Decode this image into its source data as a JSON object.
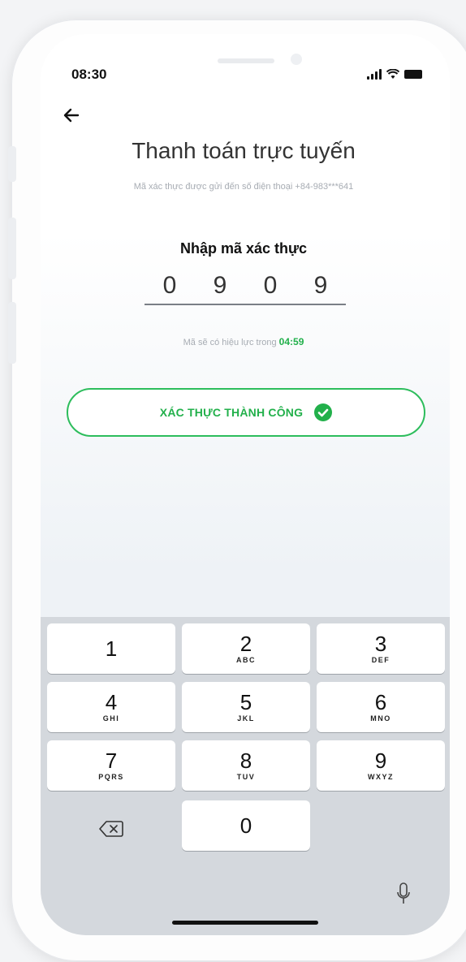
{
  "status_bar": {
    "time": "08:30"
  },
  "header": {
    "title": "Thanh toán trực tuyến",
    "subtitle": "Mã xác thực được gửi đến số điện thoại +84-983***641"
  },
  "otp": {
    "label": "Nhập mã xác thực",
    "digits": [
      "0",
      "9",
      "0",
      "9"
    ],
    "validity_text": "Mã sẽ có hiệu lực trong",
    "timer": "04:59"
  },
  "success_button": {
    "label": "XÁC THỰC THÀNH CÔNG"
  },
  "keypad": {
    "keys": [
      {
        "num": "1",
        "letters": ""
      },
      {
        "num": "2",
        "letters": "ABC"
      },
      {
        "num": "3",
        "letters": "DEF"
      },
      {
        "num": "4",
        "letters": "GHI"
      },
      {
        "num": "5",
        "letters": "JKL"
      },
      {
        "num": "6",
        "letters": "MNO"
      },
      {
        "num": "7",
        "letters": "PQRS"
      },
      {
        "num": "8",
        "letters": "TUV"
      },
      {
        "num": "9",
        "letters": "WXYZ"
      },
      {
        "num": "0",
        "letters": ""
      }
    ]
  },
  "icons": {
    "back": "arrow-left-icon",
    "signal": "cellular-signal-icon",
    "wifi": "wifi-icon",
    "battery": "battery-icon",
    "check": "check-circle-icon",
    "delete": "backspace-icon",
    "mic": "microphone-icon"
  },
  "colors": {
    "accent": "#22b04b",
    "keyboard_bg": "#d4d8dd"
  }
}
